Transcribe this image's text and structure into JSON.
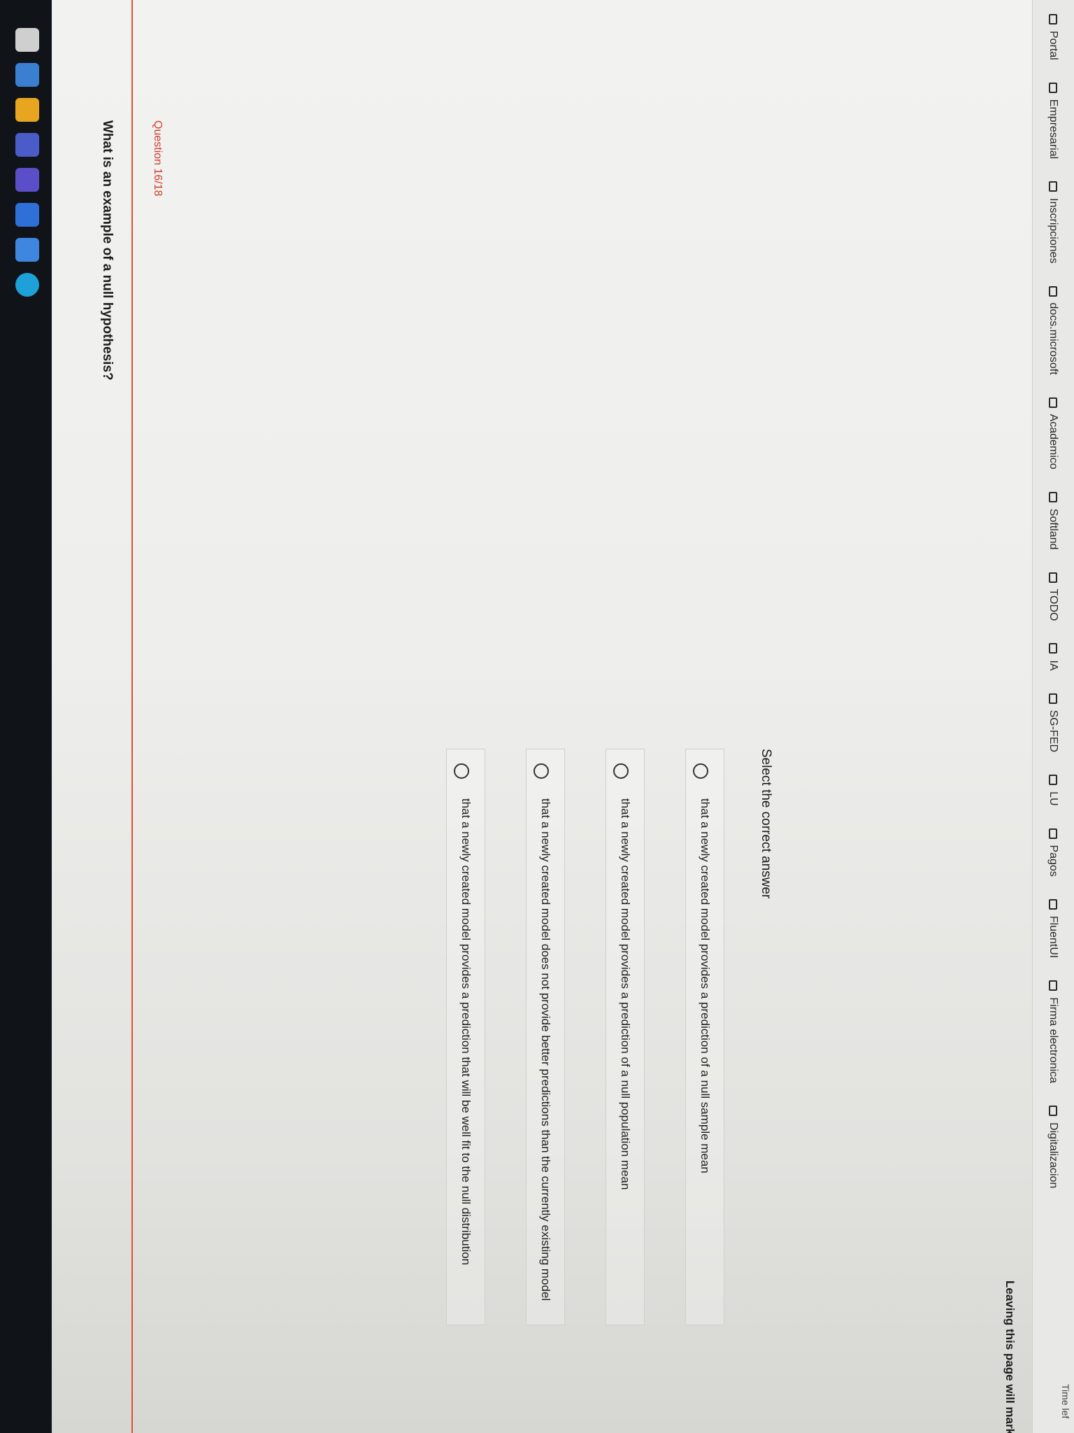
{
  "bookmarks": [
    "Portal",
    "Empresarial",
    "Inscripciones",
    "docs.microsoft",
    "Academico",
    "Softland",
    "TODO",
    "IA",
    "SG-FED",
    "LU",
    "Pagos",
    "FluentUI",
    "Firma electronica",
    "Digitalizacion"
  ],
  "notice": "Leaving this page will mark this te",
  "question": {
    "number": "Question 16/18",
    "text": "What is an example of a null hypothesis?"
  },
  "select_label": "Select the correct answer",
  "options": [
    "that a newly created model provides a prediction of a null sample mean",
    "that a newly created model provides a prediction of a null population mean",
    "that a newly created model does not provide better predictions than the currently existing model",
    "that a newly created model provides a prediction that will be well fit to the null distribution"
  ],
  "time_left": "Time lef",
  "colors": {
    "question_number": "#d23d2a",
    "accent_line": "#e0502e",
    "taskbar": "#101418"
  }
}
